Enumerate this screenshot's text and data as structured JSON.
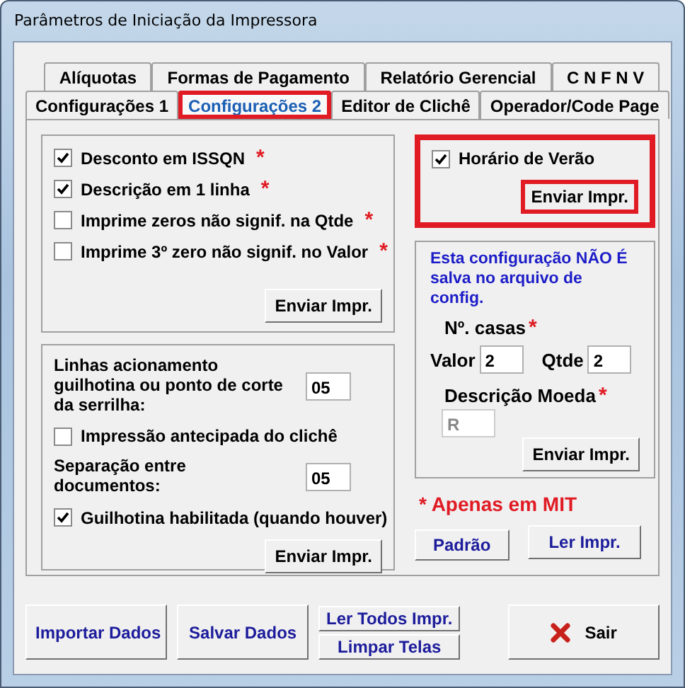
{
  "window": {
    "title": "Parâmetros de Iniciação da Impressora"
  },
  "tab_rows": [
    [
      {
        "label": "Alíquotas",
        "selected": false,
        "highlighted": false
      },
      {
        "label": "Formas de Pagamento",
        "selected": false,
        "highlighted": false
      },
      {
        "label": "Relatório Gerencial",
        "selected": false,
        "highlighted": false
      },
      {
        "label": "C N F N V",
        "selected": false,
        "highlighted": false
      }
    ],
    [
      {
        "label": "Configurações 1",
        "selected": false,
        "highlighted": false
      },
      {
        "label": "Configurações 2",
        "selected": true,
        "highlighted": true
      },
      {
        "label": "Editor de Clichê",
        "selected": false,
        "highlighted": false
      },
      {
        "label": "Operador/Code Page",
        "selected": false,
        "highlighted": false
      }
    ]
  ],
  "options_group": {
    "items": [
      {
        "label": "Desconto em ISSQN",
        "checked": true,
        "mark": "*"
      },
      {
        "label": "Descrição em 1 linha",
        "checked": true,
        "mark": "*"
      },
      {
        "label": "Imprime zeros não signif. na Qtde",
        "checked": false,
        "mark": "*"
      },
      {
        "label": "Imprime 3º zero não signif. no Valor",
        "checked": false,
        "mark": "*"
      }
    ],
    "button": "Enviar Impr."
  },
  "cutter_group": {
    "items": [
      {
        "kind": "field",
        "label": "Linhas acionamento guilhotina ou ponto de corte da serrilha:",
        "value": "05"
      },
      {
        "kind": "checkbox",
        "label": "Impressão antecipada do clichê",
        "checked": false
      },
      {
        "kind": "field",
        "label": "Separação entre documentos:",
        "value": "05"
      },
      {
        "kind": "checkbox",
        "label": "Guilhotina habilitada (quando houver)",
        "checked": true
      }
    ],
    "button": "Enviar Impr."
  },
  "daylight_group": {
    "label": "Horário de Verão",
    "checked": true,
    "button": "Enviar Impr.",
    "highlighted": true
  },
  "decimals_group": {
    "note": "Esta configuração NÃO É salva no arquivo de config.",
    "places_label": "Nº. casas",
    "places_mark": "*",
    "valor_label": "Valor",
    "valor_value": "2",
    "qtde_label": "Qtde",
    "qtde_value": "2",
    "currency_label": "Descrição Moeda",
    "currency_mark": "*",
    "currency_value": "R",
    "currency_disabled": true,
    "button": "Enviar Impr."
  },
  "mit_note": "* Apenas em MIT",
  "panel_buttons": [
    "Padrão",
    "Ler Impr."
  ],
  "footer": {
    "import_button": "Importar Dados",
    "save_button": "Salvar Dados",
    "read_all_button": "Ler Todos Impr.",
    "clear_button": "Limpar Telas",
    "exit_button": "Sair"
  }
}
